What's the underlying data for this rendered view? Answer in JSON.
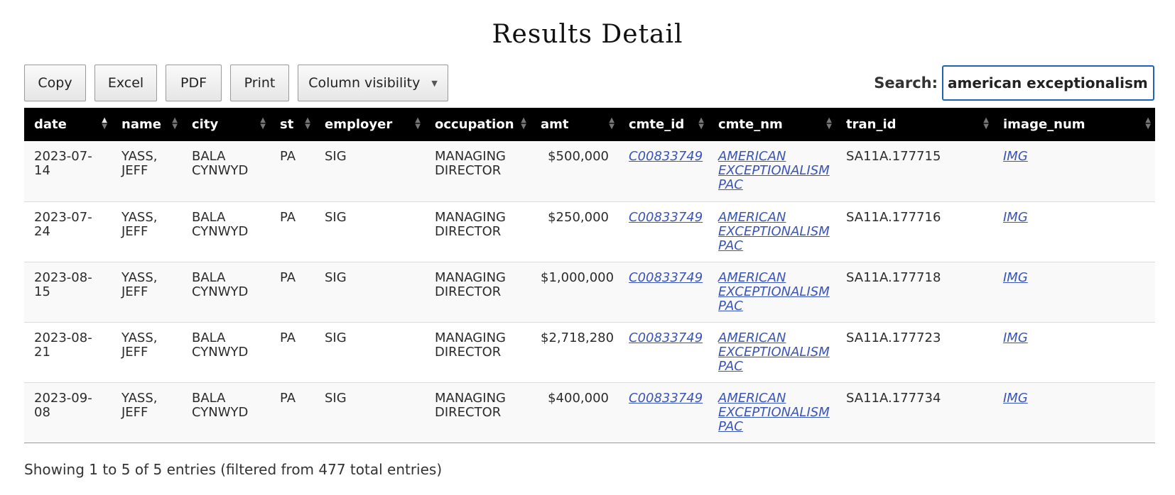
{
  "page": {
    "title": "Results Detail"
  },
  "toolbar": {
    "copy": "Copy",
    "excel": "Excel",
    "pdf": "PDF",
    "print": "Print",
    "column_visibility": "Column visibility",
    "caret": "▼"
  },
  "search": {
    "label": "Search:",
    "value": "american exceptionalism"
  },
  "table": {
    "columns": [
      "date",
      "name",
      "city",
      "st",
      "employer",
      "occupation",
      "amt",
      "cmte_id",
      "cmte_nm",
      "tran_id",
      "image_num"
    ],
    "sort": {
      "column": "date",
      "direction": "asc"
    },
    "rows": [
      [
        "2023-07-14",
        "YASS, JEFF",
        "BALA CYNWYD",
        "PA",
        "SIG",
        "MANAGING DIRECTOR",
        "$500,000",
        "C00833749",
        "AMERICAN EXCEPTIONALISM PAC",
        "SA11A.177715",
        "IMG"
      ],
      [
        "2023-07-24",
        "YASS, JEFF",
        "BALA CYNWYD",
        "PA",
        "SIG",
        "MANAGING DIRECTOR",
        "$250,000",
        "C00833749",
        "AMERICAN EXCEPTIONALISM PAC",
        "SA11A.177716",
        "IMG"
      ],
      [
        "2023-08-15",
        "YASS, JEFF",
        "BALA CYNWYD",
        "PA",
        "SIG",
        "MANAGING DIRECTOR",
        "$1,000,000",
        "C00833749",
        "AMERICAN EXCEPTIONALISM PAC",
        "SA11A.177718",
        "IMG"
      ],
      [
        "2023-08-21",
        "YASS, JEFF",
        "BALA CYNWYD",
        "PA",
        "SIG",
        "MANAGING DIRECTOR",
        "$2,718,280",
        "C00833749",
        "AMERICAN EXCEPTIONALISM PAC",
        "SA11A.177723",
        "IMG"
      ],
      [
        "2023-09-08",
        "YASS, JEFF",
        "BALA CYNWYD",
        "PA",
        "SIG",
        "MANAGING DIRECTOR",
        "$400,000",
        "C00833749",
        "AMERICAN EXCEPTIONALISM PAC",
        "SA11A.177734",
        "IMG"
      ]
    ]
  },
  "info": "Showing 1 to 5 of 5 entries (filtered from 477 total entries)",
  "colors": {
    "header_bg": "#000000",
    "link": "#3a55b8",
    "search_border": "#1f63b5"
  }
}
